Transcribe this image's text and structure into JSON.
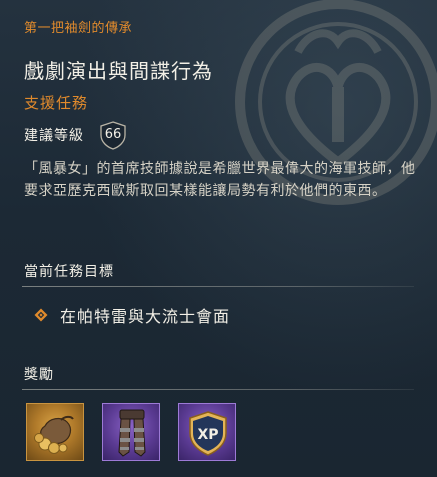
{
  "breadcrumb": "第一把袖劍的傳承",
  "quest": {
    "title": "戲劇演出與間諜行為",
    "type": "支援任務",
    "level_label": "建議等級",
    "level": "66",
    "description": "「風暴女」的首席技師據說是希臘世界最偉大的海軍技師，他要求亞歷克西歐斯取回某樣能讓局勢有利於他們的東西。"
  },
  "objectives": {
    "heading": "當前任務目標",
    "items": [
      {
        "text": "在帕特雷與大流士會面"
      }
    ]
  },
  "rewards": {
    "heading": "獎勵",
    "items": [
      {
        "icon": "coin-bag-icon",
        "rarity_color": "#c99440"
      },
      {
        "icon": "leg-armor-icon",
        "rarity_color": "#9d7ad6"
      },
      {
        "icon": "xp-shield-icon",
        "label": "XP",
        "rarity_color": "#9d7ad6"
      }
    ]
  },
  "colors": {
    "accent": "#e08a2c",
    "text": "#f2efe6",
    "background": "#1e2b37"
  }
}
